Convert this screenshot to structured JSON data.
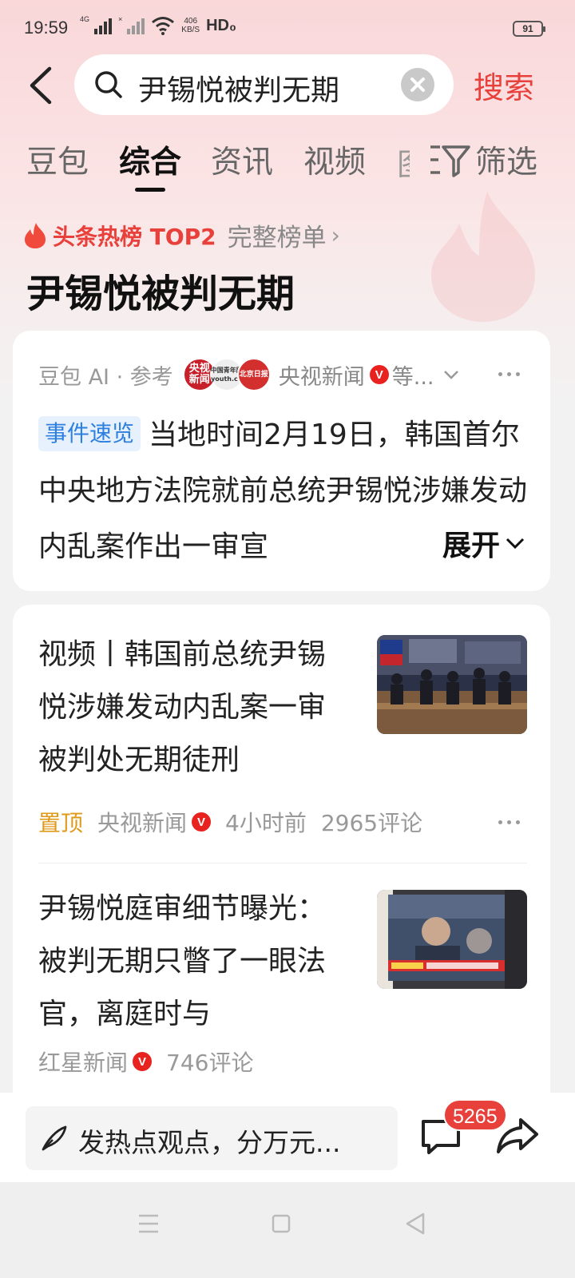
{
  "status_bar": {
    "time": "19:59",
    "sig1_label": "4G",
    "sig2_label": "×",
    "net_speed_value": "406",
    "net_speed_unit": "KB/S",
    "hd": "HD₀",
    "battery": "91"
  },
  "search": {
    "query": "尹锡悦被判无期",
    "submit_label": "搜索"
  },
  "tabs": [
    {
      "label": "豆包"
    },
    {
      "label": "综合"
    },
    {
      "label": "资讯"
    },
    {
      "label": "视频"
    }
  ],
  "tab_partial": "图",
  "filter_label": "筛选",
  "hot": {
    "label": "头条热榜 TOP2",
    "full_list": "完整榜单",
    "chevron": "›"
  },
  "topic_title": "尹锡悦被判无期",
  "ai_card": {
    "source": "豆包 AI · 参考",
    "avatars": [
      "央视\n新闻",
      "中国青年网\nyouth.cn",
      "北京日报"
    ],
    "media": "央视新闻",
    "verified": "V",
    "etc": "等...",
    "tag": "事件速览",
    "text": "当地时间2月19日，韩国首尔中央地方法院就前总统尹锡悦涉嫌发动内乱案作出一审宣",
    "expand_label": "展开"
  },
  "news": [
    {
      "title": "视频丨韩国前总统尹锡悦涉嫌发动内乱案一审被判处无期徒刑",
      "pin": "置顶",
      "source": "央视新闻",
      "verified": "V",
      "time": "4小时前",
      "comments": "2965评论"
    },
    {
      "title": "尹锡悦庭审细节曝光：被判无期只瞥了一眼法官，离庭时与",
      "source": "红星新闻",
      "verified": "V",
      "comments": "746评论"
    }
  ],
  "bottom": {
    "placeholder": "发热点观点，分万元...",
    "comment_count": "5265"
  },
  "icons": {
    "back": "back-arrow-icon",
    "search": "search-icon",
    "clear": "clear-icon",
    "filter": "filter-icon",
    "flame": "flame-icon",
    "chevron_down": "chevron-down-icon",
    "more": "more-icon",
    "pen": "pen-icon",
    "comment": "comment-icon",
    "share": "share-icon",
    "menu": "menu-icon",
    "home": "home-icon",
    "nav_back": "nav-back-icon"
  },
  "colors": {
    "accent": "#e8403a",
    "tag_blue": "#2d7fe0",
    "pin_orange": "#e09a1a",
    "verified_red": "#e8221f"
  }
}
